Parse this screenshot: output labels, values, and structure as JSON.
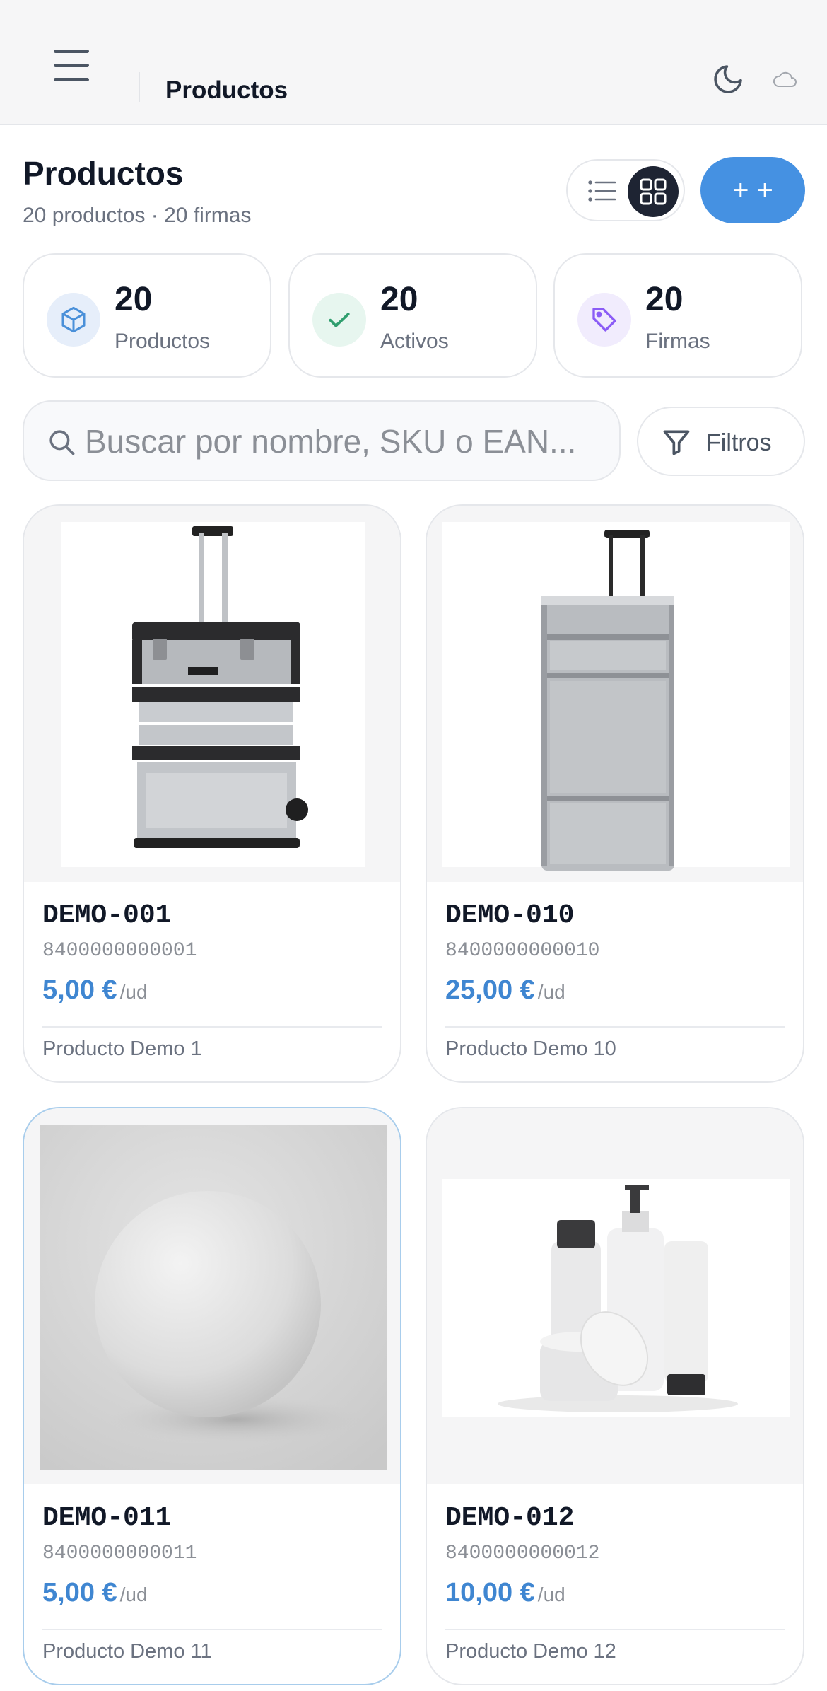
{
  "appbar": {
    "title": "Productos",
    "menu_icon": "hamburger-menu-icon",
    "theme_icon": "moon-icon",
    "sync_icon": "cloud-icon"
  },
  "header": {
    "title": "Productos",
    "subtitle": "20 productos · 20 firmas",
    "add_button_label": "+ +",
    "view_modes": [
      "list",
      "grid"
    ],
    "active_view": "grid"
  },
  "stats": [
    {
      "value": "20",
      "label": "Productos",
      "icon": "box-icon",
      "color": "#4a90d9"
    },
    {
      "value": "20",
      "label": "Activos",
      "icon": "check-icon",
      "color": "#2f9e6e"
    },
    {
      "value": "20",
      "label": "Firmas",
      "icon": "tag-icon",
      "color": "#8b5cf6"
    }
  ],
  "search": {
    "placeholder": "Buscar por nombre, SKU o EAN...",
    "value": ""
  },
  "filters": {
    "label": "Filtros"
  },
  "products": [
    {
      "sku": "DEMO-001",
      "ean": "8400000000001",
      "price": "5,00 €",
      "unit": "/ud",
      "name": "Producto Demo 1",
      "image": "toolbox-trolley"
    },
    {
      "sku": "DEMO-010",
      "ean": "8400000000010",
      "price": "25,00 €",
      "unit": "/ud",
      "name": "Producto Demo 10",
      "image": "aluminum-case-trolley"
    },
    {
      "sku": "DEMO-011",
      "ean": "8400000000011",
      "price": "5,00 €",
      "unit": "/ud",
      "name": "Producto Demo 11",
      "image": "white-sphere"
    },
    {
      "sku": "DEMO-012",
      "ean": "8400000000012",
      "price": "10,00 €",
      "unit": "/ud",
      "name": "Producto Demo 12",
      "image": "cosmetic-bottles"
    }
  ],
  "colors": {
    "accent": "#4591e2",
    "price": "#3f86d1",
    "dark": "#1e2433"
  }
}
